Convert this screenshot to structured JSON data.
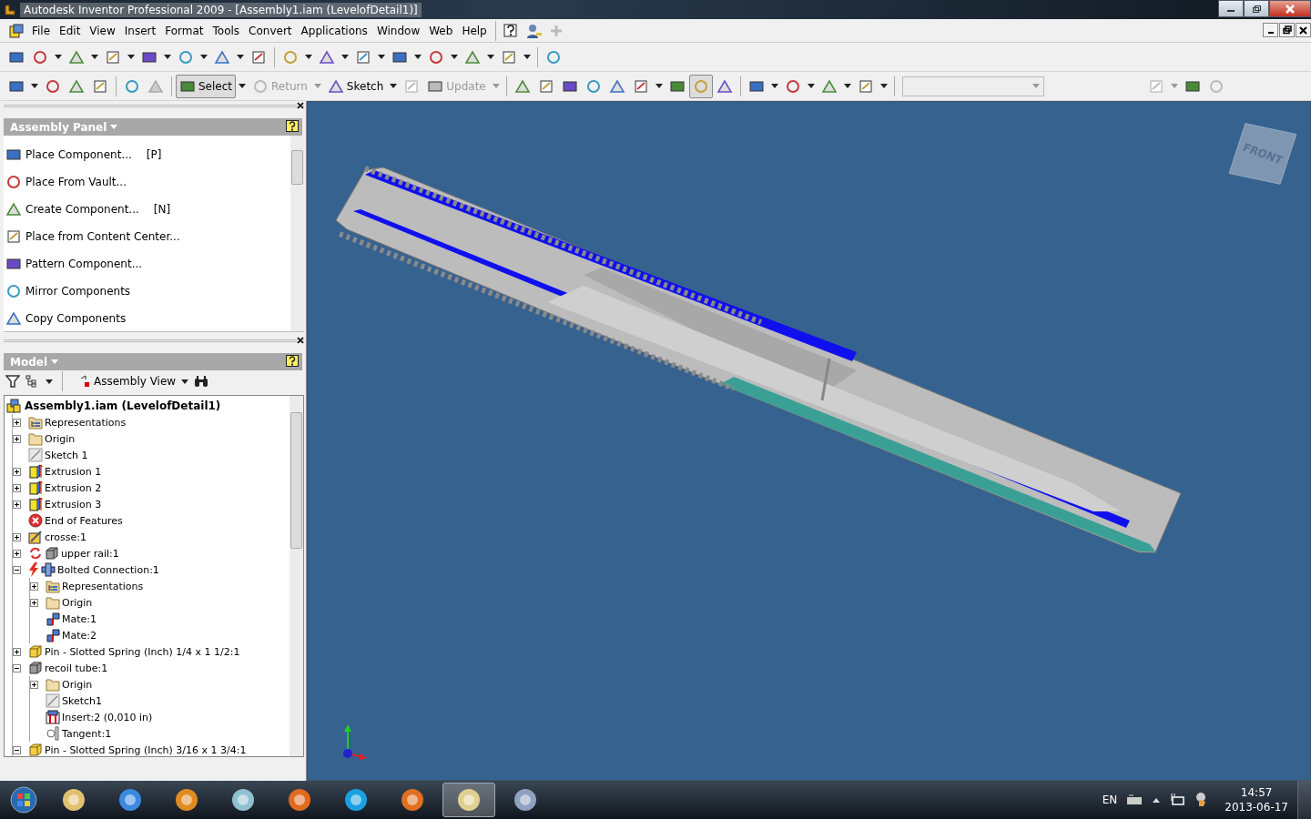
{
  "window": {
    "title": "Autodesk Inventor Professional 2009 - [Assembly1.iam (LevelofDetail1)]"
  },
  "menu": [
    "File",
    "Edit",
    "View",
    "Insert",
    "Format",
    "Tools",
    "Convert",
    "Applications",
    "Window",
    "Web",
    "Help"
  ],
  "toolbar_1": [
    {
      "kind": "icon",
      "dropdown": false,
      "disabled": false,
      "selected": false
    },
    {
      "kind": "icon",
      "dropdown": true,
      "disabled": false,
      "selected": false
    },
    {
      "kind": "icon",
      "dropdown": true,
      "disabled": false,
      "selected": false
    },
    {
      "kind": "icon",
      "dropdown": true,
      "disabled": false,
      "selected": false
    },
    {
      "kind": "icon",
      "dropdown": true,
      "disabled": false,
      "selected": false
    },
    {
      "kind": "icon",
      "dropdown": true,
      "disabled": false,
      "selected": false
    },
    {
      "kind": "icon",
      "dropdown": true,
      "disabled": false,
      "selected": false
    },
    {
      "kind": "icon",
      "dropdown": false,
      "disabled": false,
      "selected": false
    },
    {
      "kind": "separator"
    },
    {
      "kind": "icon",
      "dropdown": true,
      "disabled": false,
      "selected": false
    },
    {
      "kind": "icon",
      "dropdown": true,
      "disabled": false,
      "selected": false
    },
    {
      "kind": "icon",
      "dropdown": true,
      "disabled": false,
      "selected": false
    },
    {
      "kind": "icon",
      "dropdown": true,
      "disabled": false,
      "selected": false
    },
    {
      "kind": "icon",
      "dropdown": true,
      "disabled": false,
      "selected": false
    },
    {
      "kind": "icon",
      "dropdown": true,
      "disabled": false,
      "selected": false
    },
    {
      "kind": "icon",
      "dropdown": true,
      "disabled": false,
      "selected": false
    },
    {
      "kind": "separator"
    },
    {
      "kind": "icon",
      "dropdown": false,
      "disabled": false,
      "selected": false
    }
  ],
  "toolbar_2": [
    {
      "kind": "icon",
      "dropdown": true,
      "disabled": false,
      "selected": false
    },
    {
      "kind": "icon",
      "dropdown": false,
      "disabled": false,
      "selected": false
    },
    {
      "kind": "icon",
      "dropdown": false,
      "disabled": false,
      "selected": false
    },
    {
      "kind": "icon",
      "dropdown": false,
      "disabled": false,
      "selected": false
    },
    {
      "kind": "separator"
    },
    {
      "kind": "icon",
      "dropdown": false,
      "disabled": false,
      "selected": false
    },
    {
      "kind": "icon",
      "dropdown": false,
      "disabled": true,
      "selected": false
    },
    {
      "kind": "separator"
    },
    {
      "kind": "labeled",
      "label": "Select",
      "dropdown": true,
      "disabled": false,
      "selected": true
    },
    {
      "kind": "labeled",
      "label": "Return",
      "dropdown": true,
      "disabled": true,
      "selected": false
    },
    {
      "kind": "labeled",
      "label": "Sketch",
      "dropdown": true,
      "disabled": false,
      "selected": false
    },
    {
      "kind": "icon",
      "dropdown": false,
      "disabled": true,
      "selected": false
    },
    {
      "kind": "labeled",
      "label": "Update",
      "dropdown": true,
      "disabled": true,
      "selected": false
    },
    {
      "kind": "separator"
    },
    {
      "kind": "icon",
      "dropdown": false,
      "disabled": false,
      "selected": false
    },
    {
      "kind": "icon",
      "dropdown": false,
      "disabled": false,
      "selected": false
    },
    {
      "kind": "icon",
      "dropdown": false,
      "disabled": false,
      "selected": false
    },
    {
      "kind": "icon",
      "dropdown": false,
      "disabled": false,
      "selected": false
    },
    {
      "kind": "icon",
      "dropdown": false,
      "disabled": false,
      "selected": false
    },
    {
      "kind": "icon",
      "dropdown": true,
      "disabled": false,
      "selected": false
    },
    {
      "kind": "icon",
      "dropdown": false,
      "disabled": false,
      "selected": false
    },
    {
      "kind": "icon",
      "dropdown": false,
      "disabled": false,
      "selected": true
    },
    {
      "kind": "icon",
      "dropdown": false,
      "disabled": false,
      "selected": false
    },
    {
      "kind": "separator"
    },
    {
      "kind": "icon",
      "dropdown": true,
      "disabled": false,
      "selected": false
    },
    {
      "kind": "icon",
      "dropdown": true,
      "disabled": false,
      "selected": false
    },
    {
      "kind": "icon",
      "dropdown": true,
      "disabled": false,
      "selected": false
    },
    {
      "kind": "icon",
      "dropdown": true,
      "disabled": false,
      "selected": false
    },
    {
      "kind": "separator"
    },
    {
      "kind": "combo"
    },
    {
      "kind": "spacer"
    },
    {
      "kind": "icon",
      "dropdown": true,
      "disabled": true,
      "selected": false
    },
    {
      "kind": "icon",
      "dropdown": false,
      "disabled": false,
      "selected": false
    },
    {
      "kind": "icon",
      "dropdown": false,
      "disabled": true,
      "selected": false
    }
  ],
  "assembly_panel": {
    "title": "Assembly Panel",
    "items": [
      {
        "label": "Place Component...",
        "shortcut": "[P]"
      },
      {
        "label": "Place From Vault..."
      },
      {
        "label": "Create Component...",
        "shortcut": "[N]"
      },
      {
        "label": "Place from Content Center..."
      },
      {
        "label": "Pattern Component..."
      },
      {
        "label": "Mirror Components"
      },
      {
        "label": "Copy Components"
      }
    ]
  },
  "model_panel": {
    "title": "Model",
    "view": "Assembly View",
    "tree": {
      "label": "Assembly1.iam (LevelofDetail1)",
      "kind": "assembly",
      "children": [
        {
          "label": "Representations",
          "kind": "representations",
          "expanded": false
        },
        {
          "label": "Origin",
          "kind": "folder",
          "expanded": false
        },
        {
          "label": "Sketch 1",
          "kind": "sketch"
        },
        {
          "label": "Extrusion 1",
          "kind": "extrusion",
          "expanded": false
        },
        {
          "label": "Extrusion 2",
          "kind": "extrusion",
          "expanded": false
        },
        {
          "label": "Extrusion 3",
          "kind": "extrusion",
          "expanded": false
        },
        {
          "label": "End of Features",
          "kind": "end"
        },
        {
          "label": "crosse:1",
          "kind": "sketchpart",
          "expanded": false
        },
        {
          "label": "upper rail:1",
          "kind": "part",
          "adaptive": true,
          "expanded": false
        },
        {
          "label": "Bolted Connection:1",
          "kind": "bolted",
          "accelerator": true,
          "expanded": true,
          "children": [
            {
              "label": "Representations",
              "kind": "representations",
              "expanded": false
            },
            {
              "label": "Origin",
              "kind": "folder",
              "expanded": false
            },
            {
              "label": "Mate:1",
              "kind": "mate"
            },
            {
              "label": "Mate:2",
              "kind": "mate"
            }
          ]
        },
        {
          "label": "Pin - Slotted Spring (Inch) 1/4 x 1 1/2:1",
          "kind": "pin",
          "expanded": false
        },
        {
          "label": "recoil tube:1",
          "kind": "part",
          "expanded": true,
          "children": [
            {
              "label": "Origin",
              "kind": "folder",
              "expanded": false
            },
            {
              "label": "Sketch1",
              "kind": "sketch"
            },
            {
              "label": "Insert:2 (0,010 in)",
              "kind": "insert"
            },
            {
              "label": "Tangent:1",
              "kind": "tangent"
            }
          ]
        },
        {
          "label": "Pin - Slotted Spring (Inch) 3/16 x 1 3/4:1",
          "kind": "pin",
          "expanded": true
        }
      ]
    }
  },
  "viewport": {
    "view_cube": "FRONT"
  },
  "taskbar": {
    "apps": [
      {
        "selected": false
      },
      {
        "selected": false
      },
      {
        "selected": false
      },
      {
        "selected": false
      },
      {
        "selected": false
      },
      {
        "selected": false
      },
      {
        "selected": false
      },
      {
        "selected": true
      },
      {
        "selected": false
      }
    ],
    "language": "EN",
    "time": "14:57",
    "date": "2013-06-17"
  }
}
